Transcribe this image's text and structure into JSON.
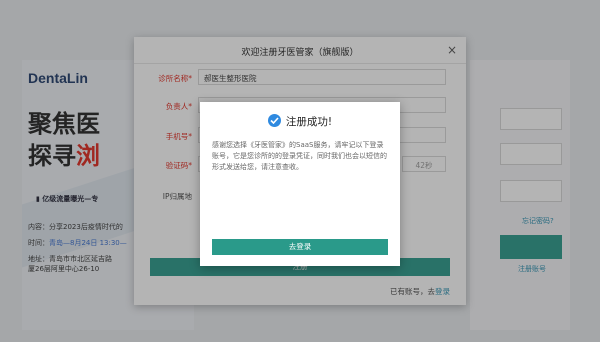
{
  "background": {
    "logo": "DentaLin",
    "headline_1": "聚焦医",
    "headline_2": "探寻",
    "headline_2_red": "浏",
    "tagline": "亿级流量曝光—专",
    "info_content": "内容：分享2023后疫情时代的",
    "info_time": "时间：",
    "info_time_hl": "青岛—8月24日 13:30—",
    "info_address": "地址：青岛市市北区延吉路",
    "info_address_2": "厦26层阿里中心26-10",
    "forgot_password": "忘记密码?",
    "register_account": "注册账号"
  },
  "dialog": {
    "title": "欢迎注册牙医管家（旗舰版）",
    "close_label": "×",
    "fields": {
      "clinic_name_label": "诊所名称*",
      "clinic_name_value": "郝医生整形医院",
      "contact_label": "负责人*",
      "phone_label": "手机号*",
      "code_label": "验证码*",
      "code_countdown": "42秒",
      "ip_label": "IP归属地"
    },
    "submit_label": "注册",
    "login_prompt": "已有账号，去",
    "login_link": "登录"
  },
  "popup": {
    "title": "注册成功!",
    "message": "感谢您选择《牙医管家》的SaaS服务，请牢记以下登录账号，它是您诊所的的登录凭证，同时我们也会以短信的形式发送给您，请注意查收。",
    "button": "去登录"
  },
  "colors": {
    "primary": "#2a9a8a",
    "link": "#2a8fb0",
    "required": "#e0281e",
    "success_icon": "#2f8ae0"
  }
}
